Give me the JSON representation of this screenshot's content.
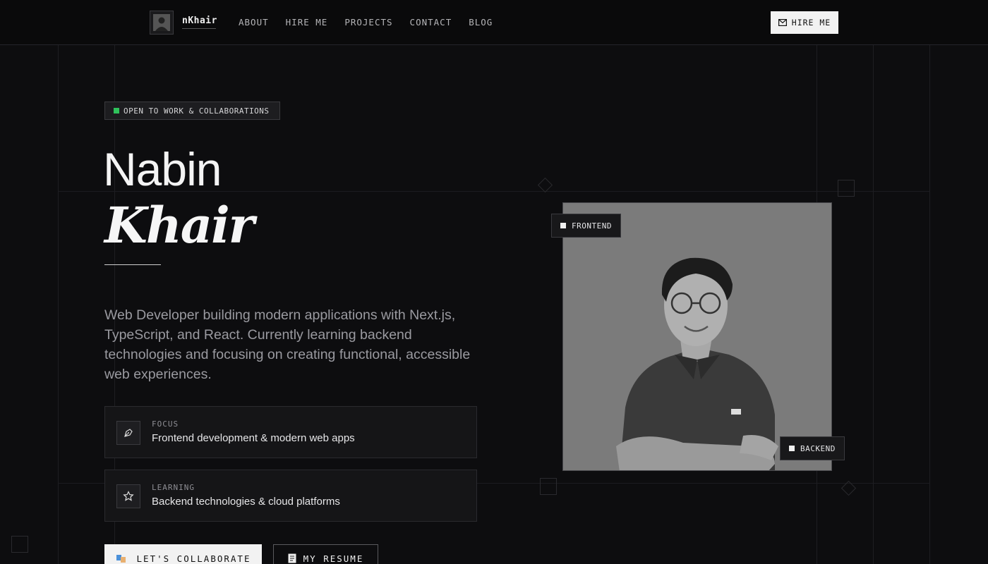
{
  "header": {
    "logo_text": "nKhair",
    "nav": [
      "ABOUT",
      "HIRE ME",
      "PROJECTS",
      "CONTACT",
      "BLOG"
    ],
    "hire_button": "HIRE ME"
  },
  "hero": {
    "badge": "OPEN TO WORK & COLLABORATIONS",
    "first_name": "Nabin",
    "last_name": "Khair",
    "description": "Web Developer building modern applications with Next.js, TypeScript, and React. Currently learning backend technologies and focusing on creating functional, accessible web experiences.",
    "cards": [
      {
        "label": "FOCUS",
        "value": "Frontend development & modern web apps",
        "icon": "pen-tool-icon"
      },
      {
        "label": "LEARNING",
        "value": "Backend technologies & cloud platforms",
        "icon": "star-icon"
      }
    ],
    "primary_button": "LET'S COLLABORATE",
    "secondary_button": "MY RESUME"
  },
  "photo": {
    "tags": [
      "FRONTEND",
      "BACKEND"
    ]
  },
  "colors": {
    "background": "#0d0d0f",
    "status_green": "#2fc25b",
    "button_light": "#f2f2f2"
  }
}
